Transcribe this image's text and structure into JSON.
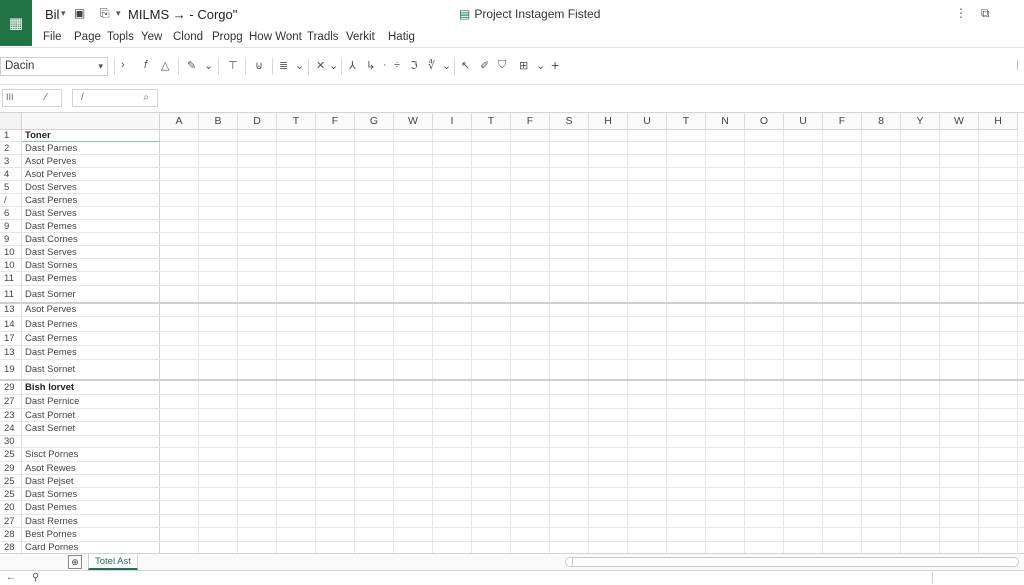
{
  "title_bar": {
    "app_icon": "spreadsheet-icon",
    "file_label": "Bil",
    "path_text": "MILMS → - Corgo\"",
    "center_title": "Project Instagem Fisted"
  },
  "menu": [
    "File",
    "Page",
    "Topls",
    "Yew",
    "Clond",
    "Propg",
    "How Wont",
    "Tradls",
    "Verkit",
    "Hatig"
  ],
  "toolbar": {
    "font_value": "Dacin"
  },
  "formula_bar": {
    "name_box_left": "III",
    "name_box_right": "⁄",
    "fx_left": "/",
    "fx_right": "⌕"
  },
  "grid": {
    "columns": [
      "A",
      "B",
      "D",
      "T",
      "F",
      "G",
      "W",
      "I",
      "T",
      "F",
      "S",
      "H",
      "U",
      "T",
      "N",
      "O",
      "U",
      "F",
      "8",
      "Y",
      "W",
      "H"
    ],
    "rows": [
      {
        "num": "1",
        "label": "Toner",
        "bold": true
      },
      {
        "num": "2",
        "label": "Dast Parnes"
      },
      {
        "num": "3",
        "label": "Asot Perves"
      },
      {
        "num": "4",
        "label": "Asot Perves"
      },
      {
        "num": "5",
        "label": "Dost Serves"
      },
      {
        "num": "/",
        "label": "Cast Pernes"
      },
      {
        "num": "6",
        "label": "Dast Serves"
      },
      {
        "num": "9",
        "label": "Dast Pemes"
      },
      {
        "num": "9",
        "label": "Dast Cornes"
      },
      {
        "num": "10",
        "label": "Dast Serves"
      },
      {
        "num": "10",
        "label": "Dast Sornes"
      },
      {
        "num": "11",
        "label": "Dast Pemes"
      },
      {
        "num": "11",
        "label": "Dast Sorner"
      },
      {
        "num": "13",
        "label": "Asot Perves"
      },
      {
        "num": "14",
        "label": "Dast Pernes"
      },
      {
        "num": "17",
        "label": "Cast Pernes"
      },
      {
        "num": "13",
        "label": "Dast Pemes"
      },
      {
        "num": "19",
        "label": "Dast Sornet"
      },
      {
        "num": "29",
        "label": "Bish lorvet",
        "bold": true
      },
      {
        "num": "27",
        "label": "Dast Pernice"
      },
      {
        "num": "23",
        "label": "Cast Pornet"
      },
      {
        "num": "24",
        "label": "Cast Sernet"
      },
      {
        "num": "30",
        "label": ""
      },
      {
        "num": "25",
        "label": "Sisct Pornes"
      },
      {
        "num": "29",
        "label": "Asot Rewes"
      },
      {
        "num": "25",
        "label": "Dast Pejset"
      },
      {
        "num": "25",
        "label": "Dast Sornes"
      },
      {
        "num": "20",
        "label": "Dast Pemes"
      },
      {
        "num": "27",
        "label": "Dast Rernes"
      },
      {
        "num": "28",
        "label": "Best Pornes"
      },
      {
        "num": "28",
        "label": "Card Pornes"
      }
    ]
  },
  "sheets": {
    "add_icon": "add-sheet-icon",
    "active_tab": "Totel Ast"
  },
  "status": {
    "left_icon": "pin-icon"
  }
}
